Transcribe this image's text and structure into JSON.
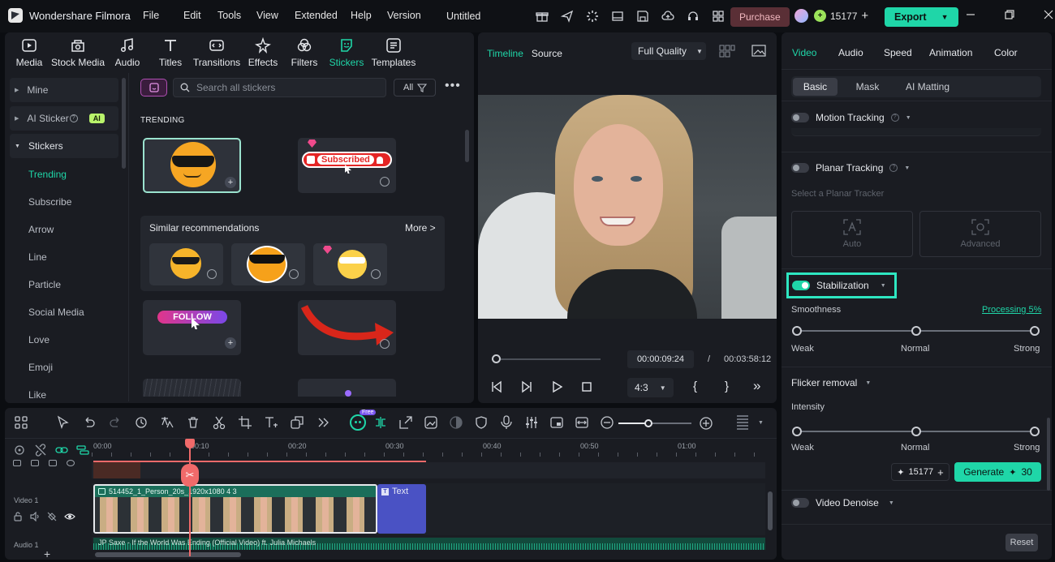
{
  "app": {
    "name": "Wondershare Filmora",
    "project_title": "Untitled"
  },
  "menu": [
    "File",
    "Edit",
    "Tools",
    "View",
    "Extended",
    "Help",
    "Version"
  ],
  "titlebar": {
    "purchase_label": "Purchase",
    "credits": "15177",
    "export_label": "Export"
  },
  "media_tabs": [
    {
      "label": "Media",
      "icon": "media-icon"
    },
    {
      "label": "Stock Media",
      "icon": "stock-media-icon"
    },
    {
      "label": "Audio",
      "icon": "music-note-icon"
    },
    {
      "label": "Titles",
      "icon": "text-t-icon"
    },
    {
      "label": "Transitions",
      "icon": "transitions-icon"
    },
    {
      "label": "Effects",
      "icon": "sparkle-icon"
    },
    {
      "label": "Filters",
      "icon": "filters-icon"
    },
    {
      "label": "Stickers",
      "icon": "sticker-icon",
      "active": true
    },
    {
      "label": "Templates",
      "icon": "templates-icon"
    }
  ],
  "sidebar": {
    "mine": "Mine",
    "ai_sticker": "AI Sticker",
    "ai_badge": "AI",
    "stickers": "Stickers",
    "items": [
      "Trending",
      "Subscribe",
      "Arrow",
      "Line",
      "Particle",
      "Social Media",
      "Love",
      "Emoji",
      "Like"
    ]
  },
  "sticker_search": {
    "placeholder": "Search all stickers",
    "filter_label": "All"
  },
  "stickers_panel": {
    "section_title": "TRENDING",
    "subscribed_text": "Subscribed",
    "similar_title": "Similar recommendations",
    "more_label": "More >",
    "follow_text": "FOLLOW"
  },
  "player": {
    "tab_timeline": "Timeline",
    "tab_source": "Source",
    "quality": "Full Quality",
    "current_time": "00:00:09:24",
    "separator": "/",
    "total_time": "00:03:58:12",
    "aspect": "4:3",
    "progress": 0.04
  },
  "props": {
    "tabs": [
      "Video",
      "Audio",
      "Speed",
      "Animation",
      "Color"
    ],
    "subtabs": [
      "Basic",
      "Mask",
      "AI Matting"
    ],
    "motion_tracking": "Motion Tracking",
    "planar_tracking": "Planar Tracking",
    "planar_placeholder": "Select a Planar Tracker",
    "auto_label": "Auto",
    "advanced_label": "Advanced",
    "stabilization": "Stabilization",
    "smoothness": "Smoothness",
    "processing": "Processing 5%",
    "weak": "Weak",
    "normal": "Normal",
    "strong": "Strong",
    "flicker_removal": "Flicker removal",
    "intensity": "Intensity",
    "credits": "15177",
    "generate_label": "Generate",
    "generate_cost": "30",
    "video_denoise": "Video Denoise",
    "reset_label": "Reset",
    "smoothness_value": 0.5,
    "intensity_value": 0.5
  },
  "timeline": {
    "ruler": [
      "00:00",
      "00:10",
      "00:20",
      "00:30",
      "00:40",
      "00:50",
      "01:00"
    ],
    "free_badge": "Free",
    "video_track_label": "Video 1",
    "audio_track_label": "Audio 1",
    "clip_name": "514452_1_Person_20s_1920x1080 4 3",
    "text_clip": "Text",
    "audio_clip": "JP Saxe - If the World Was Ending (Official Video) ft. Julia Michaels"
  }
}
